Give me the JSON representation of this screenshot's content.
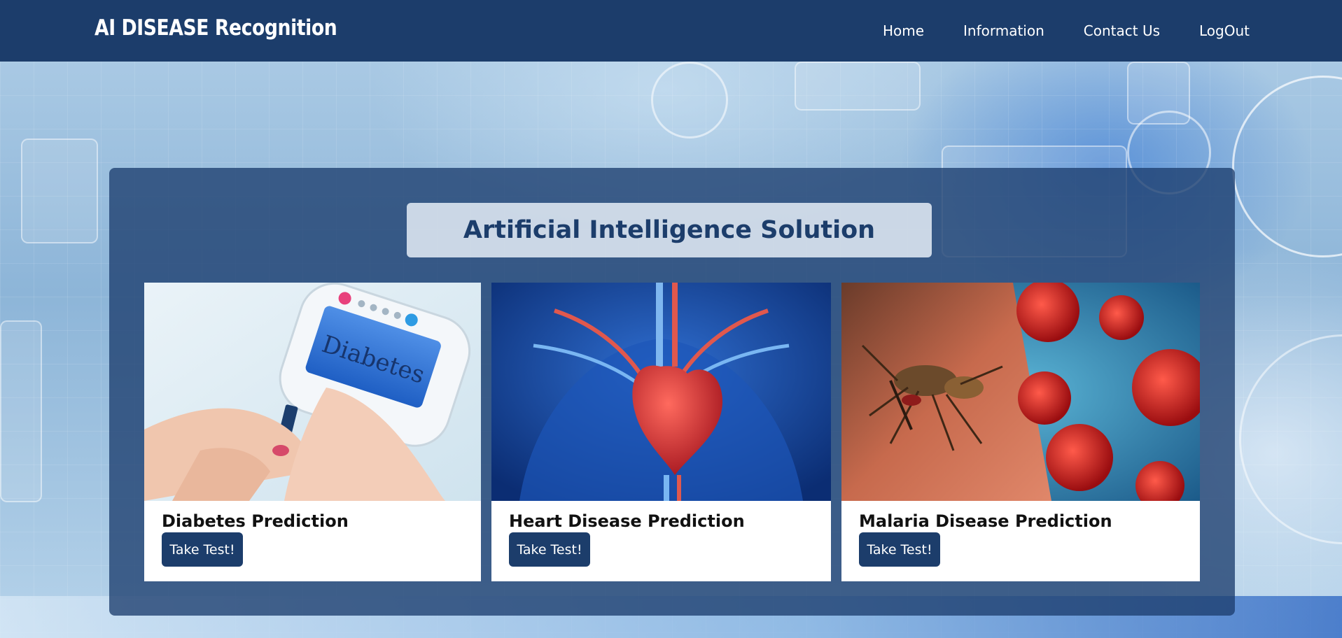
{
  "brand": "AI DISEASE Recognition",
  "nav": {
    "items": [
      {
        "label": "Home"
      },
      {
        "label": "Information"
      },
      {
        "label": "Contact Us"
      },
      {
        "label": "LogOut"
      }
    ]
  },
  "hero": {
    "headline": "Artificial Intelligence Solution"
  },
  "cards": [
    {
      "title": "Diabetes Prediction",
      "button": "Take Test!",
      "meter_text": "Diabetes"
    },
    {
      "title": "Heart Disease Prediction",
      "button": "Take Test!"
    },
    {
      "title": "Malaria Disease Prediction",
      "button": "Take Test!"
    }
  ],
  "colors": {
    "navbar": "#1c3d6b",
    "panel": "rgba(28,61,110,0.78)",
    "button": "#1c3d6b",
    "headline_text": "#1c3d6b"
  },
  "icons": [
    "diabetes-image",
    "heart-image",
    "malaria-image"
  ]
}
